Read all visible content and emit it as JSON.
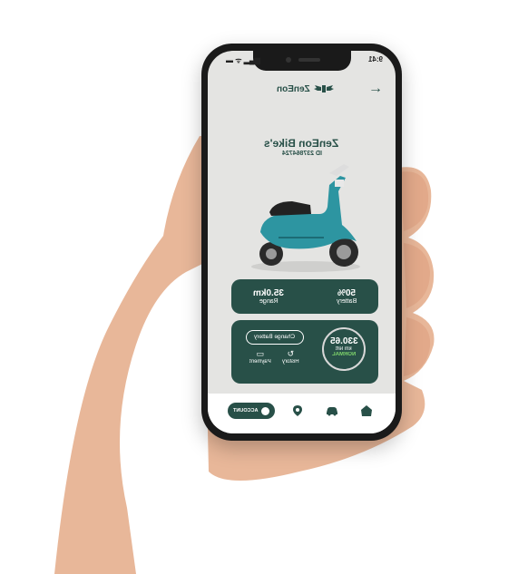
{
  "status": {
    "time": "9:41"
  },
  "header": {
    "brand": "ZenEon",
    "back_icon": "arrow-icon"
  },
  "bike": {
    "name": "ZenEon Bike's",
    "id": "ID 237864724"
  },
  "stats": {
    "range_value": "35.0km",
    "range_label": "Range",
    "battery_value": "50%",
    "battery_label": "Battery"
  },
  "panel": {
    "change_battery": "Change Battery",
    "history_label": "History",
    "payment_label": "Payment",
    "km_value": "330.65",
    "km_left": "km left",
    "mode": "NORMAL"
  },
  "nav": {
    "account_label": "ACCOUNT"
  },
  "colors": {
    "accent": "#285048",
    "mode": "#7ed36b"
  }
}
